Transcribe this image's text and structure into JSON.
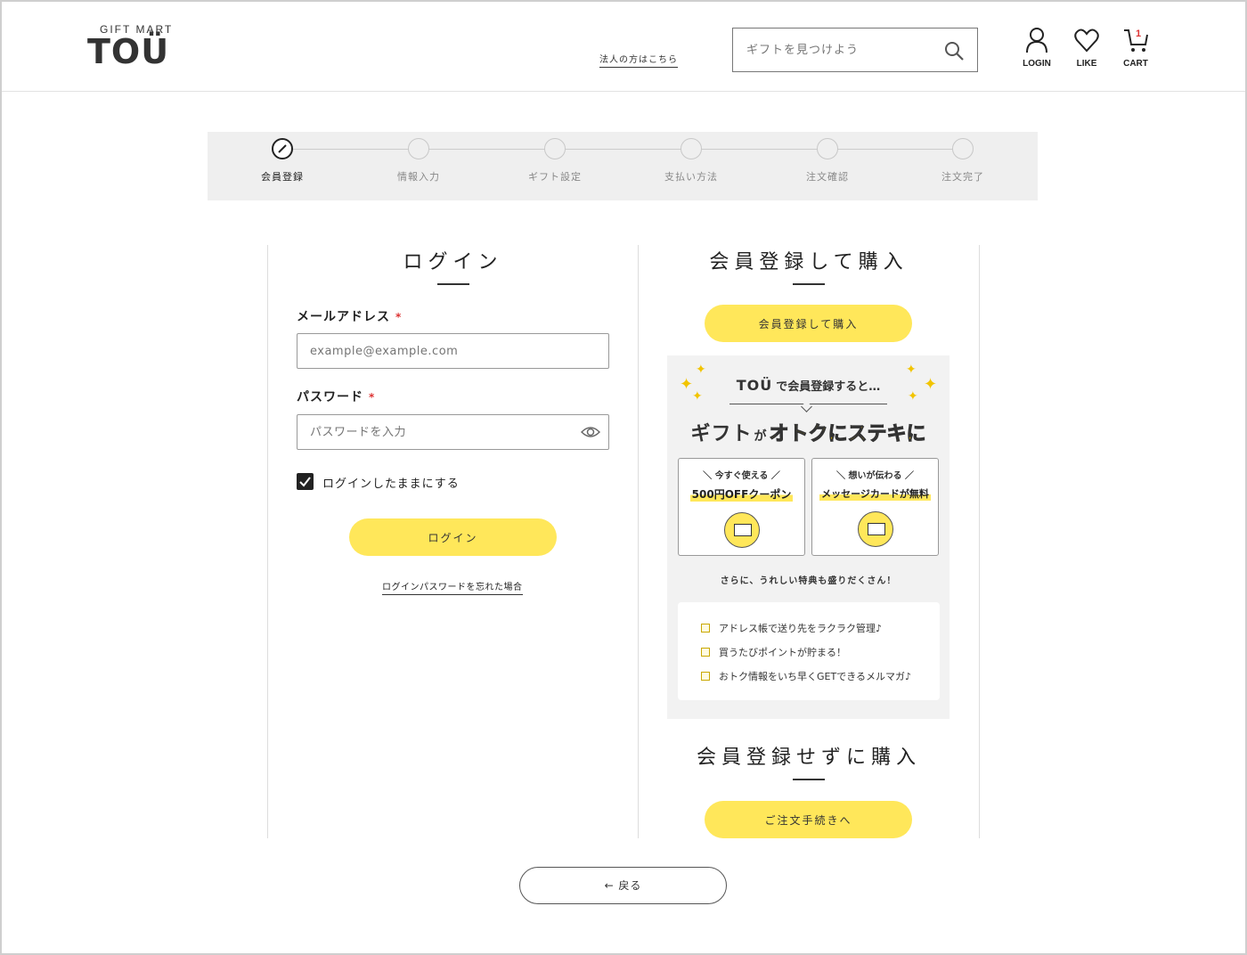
{
  "header": {
    "logo_sub": "GIFT MART",
    "logo_main": "TOÜ",
    "corporate_link": "法人の方はこちら",
    "search_placeholder": "ギフトを見つけよう",
    "nav": {
      "login": "LOGIN",
      "like": "LIKE",
      "cart": "CART",
      "cart_count": "1"
    }
  },
  "steps": [
    {
      "label": "会員登録",
      "active": true
    },
    {
      "label": "情報入力",
      "active": false
    },
    {
      "label": "ギフト設定",
      "active": false
    },
    {
      "label": "支払い方法",
      "active": false
    },
    {
      "label": "注文確認",
      "active": false
    },
    {
      "label": "注文完了",
      "active": false
    }
  ],
  "login": {
    "title": "ログイン",
    "email_label": "メールアドレス",
    "email_placeholder": "example@example.com",
    "password_label": "パスワード",
    "password_placeholder": "パスワードを入力",
    "required_mark": "*",
    "remember_label": "ログインしたままにする",
    "remember_checked": true,
    "login_button": "ログイン",
    "forgot_link": "ログインパスワードを忘れた場合"
  },
  "register": {
    "title": "会員登録して購入",
    "button": "会員登録して購入",
    "promo": {
      "top_logo": "TOÜ",
      "top_text": "で会員登録すると…",
      "head_a": "ギフト",
      "head_b": "が",
      "head_c": "オトクにステキに",
      "card1_sub": "＼ 今すぐ使える ／",
      "card1_main": "500円OFFクーポン",
      "card2_sub": "＼ 想いが伝わる ／",
      "card2_main": "メッセージカードが無料",
      "more": "さらに、うれしい特典も盛りだくさん！",
      "perks": [
        "アドレス帳で送り先をラクラク管理♪",
        "買うたびポイントが貯まる！",
        "おトク情報をいち早くGETできるメルマガ♪"
      ]
    }
  },
  "guest": {
    "title": "会員登録せずに購入",
    "button": "ご注文手続きへ"
  },
  "back_button": "← 戻る",
  "colors": {
    "accent": "#ffe75a",
    "required": "#dd3333"
  }
}
